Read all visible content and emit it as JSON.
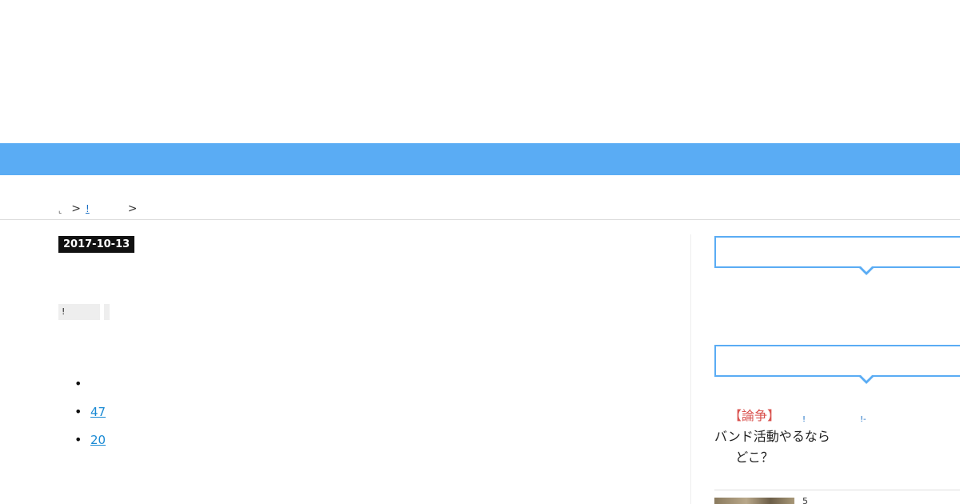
{
  "colors": {
    "nav_bar": "#5aacf4",
    "link": "#1a8ad4",
    "accent_red": "#d9534f",
    "badge_bg": "#111111"
  },
  "breadcrumb": {
    "home": "⌞",
    "separator": ">",
    "category": "!"
  },
  "post": {
    "date": "2017-10-13",
    "tags": [
      "!",
      ""
    ],
    "links": [
      "",
      "47",
      "20"
    ]
  },
  "sidebar": {
    "featured_post": {
      "tag": "【論争】",
      "line1": "バンド活動やるなら",
      "line2": "どこ？",
      "meta1": "!",
      "meta2": "!-"
    },
    "next_post_label": "5"
  }
}
